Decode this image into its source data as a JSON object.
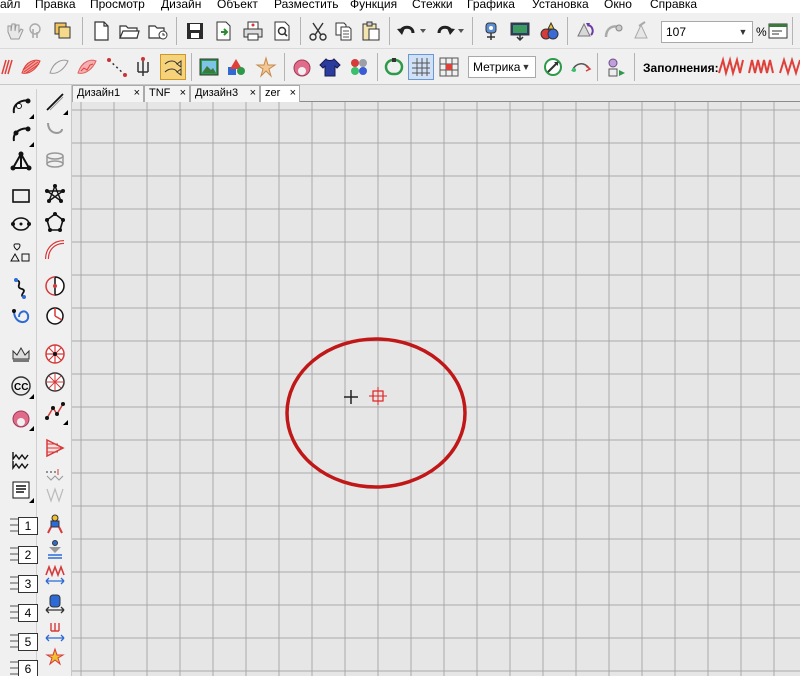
{
  "menu": {
    "items": [
      "айл",
      "Правка",
      "Просмотр",
      "Дизайн",
      "Объект",
      "Разместить",
      "Функция",
      "Стежки",
      "Графика",
      "Установка",
      "Окно",
      "Справка"
    ]
  },
  "toolbar": {
    "zoom_value": "107",
    "zoom_unit": "%",
    "units_value": "Метрика",
    "fills_label": "Заполнения:"
  },
  "tabs": [
    {
      "label": "Дизайн1",
      "close": "×"
    },
    {
      "label": "TNF",
      "close": "×"
    },
    {
      "label": "Дизайн3",
      "close": "×"
    },
    {
      "label": "zer",
      "close": "×"
    }
  ],
  "toolbox": {
    "numbered": [
      "1",
      "2",
      "3",
      "4",
      "5",
      "6"
    ]
  },
  "colors": {
    "grid_line": "#a9a9a9",
    "canvas_bg": "#e6e6e6",
    "highlight_ellipse": "#c01818",
    "fill_zigzag": "#e0403a"
  }
}
